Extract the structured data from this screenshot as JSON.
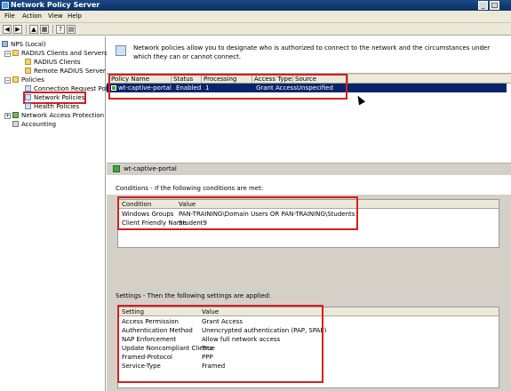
{
  "window": {
    "title": "Network Policy Server",
    "min_glyph": "_",
    "max_glyph": "□"
  },
  "menu": [
    "File",
    "Action",
    "View",
    "Help"
  ],
  "toolbar": {
    "back": "◀",
    "forward": "▶",
    "up": "▲",
    "show": "▦",
    "help": "?",
    "properties": "▤"
  },
  "tree": [
    {
      "label": "NPS (Local)",
      "icon": "server-icon"
    },
    {
      "label": "RADIUS Clients and Servers",
      "icon": "folder-icon"
    },
    {
      "label": "RADIUS Clients",
      "icon": "folder-icon"
    },
    {
      "label": "Remote RADIUS Server G",
      "icon": "folder-icon"
    },
    {
      "label": "Policies",
      "icon": "folder-icon"
    },
    {
      "label": "Connection Request Polici",
      "icon": "policy-icon"
    },
    {
      "label": "Network Policies",
      "icon": "policy-icon"
    },
    {
      "label": "Health Policies",
      "icon": "policy-icon"
    },
    {
      "label": "Network Access Protection",
      "icon": "network-icon"
    },
    {
      "label": "Accounting",
      "icon": "accounting-icon"
    }
  ],
  "expanders": [
    "−",
    "−",
    "+"
  ],
  "info_text": "Network policies allow you to designate who is authorized to connect to the network and the circumstances under which they can or cannot connect.",
  "policy_table": {
    "columns": [
      "Policy Name",
      "Status",
      "Processing Order",
      "Access Type",
      "Source"
    ],
    "rows": [
      {
        "name": "wt-captive-portal",
        "status": "Enabled",
        "order": "1",
        "access": "Grant Access",
        "source": "Unspecified"
      }
    ]
  },
  "detail_title": "wt-captive-portal",
  "conditions": {
    "label": "Conditions - If the following conditions are met:",
    "columns": [
      "Condition",
      "Value"
    ],
    "rows": [
      {
        "condition": "Windows Groups",
        "value": "PAN-TRAINING\\Domain Users OR PAN-TRAINING\\Students"
      },
      {
        "condition": "Client Friendly Name",
        "value": "Student9"
      }
    ]
  },
  "settings": {
    "label": "Settings - Then the following settings are applied:",
    "columns": [
      "Setting",
      "Value"
    ],
    "rows": [
      {
        "setting": "Access Permission",
        "value": "Grant Access"
      },
      {
        "setting": "Authentication Method",
        "value": "Unencrypted authentication (PAP, SPAP)"
      },
      {
        "setting": "NAP Enforcement",
        "value": "Allow full network access"
      },
      {
        "setting": "Update Noncompliant Clients",
        "value": "True"
      },
      {
        "setting": "Framed-Protocol",
        "value": "PPP"
      },
      {
        "setting": "Service-Type",
        "value": "Framed"
      }
    ]
  },
  "colors": {
    "highlight": "#d42020",
    "selection": "#0a246a",
    "titlebar": "#0b2f63"
  }
}
